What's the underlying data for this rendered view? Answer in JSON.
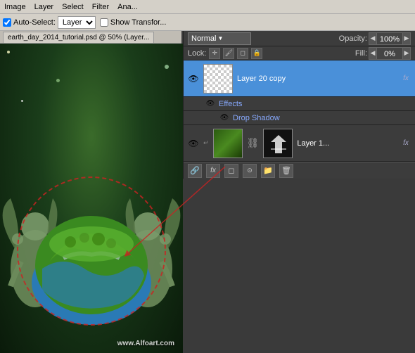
{
  "menus": {
    "items": [
      "Image",
      "Layer",
      "Select",
      "Filter",
      "Ana..."
    ]
  },
  "toolbar": {
    "autoselect_label": "Auto-Select:",
    "autoselect_option": "Layer",
    "show_transform": "Show Transfor...",
    "blend_mode": "Normal",
    "opacity_label": "Opacity:",
    "opacity_value": "100%",
    "lock_label": "Lock:",
    "fill_label": "Fill:",
    "fill_value": "0%"
  },
  "layers": {
    "layer20copy": {
      "name": "Layer 20 copy",
      "visible": true,
      "fx": "fx",
      "effects": "Effects",
      "effect_name": "Drop Shadow"
    },
    "layer1": {
      "name": "Layer 1...",
      "fx": "fx",
      "visible": true
    }
  },
  "canvas": {
    "tab_title": "earth_day_2014_tutorial.psd @ 50% (Layer...",
    "watermark": "www.Alfoart.com"
  },
  "bottom_icons": [
    "link-icon",
    "fx-icon",
    "mask-icon",
    "brush-icon",
    "folder-icon",
    "trash-icon"
  ],
  "bottom_labels": [
    "🔗",
    "fx",
    "◻",
    "⊙",
    "📁",
    "🗑"
  ]
}
